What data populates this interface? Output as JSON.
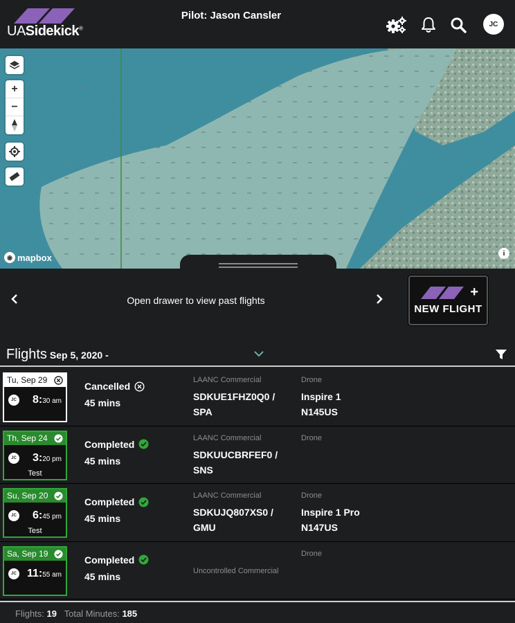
{
  "header": {
    "logo_text_light": "UA",
    "logo_text_bold": "Sidekick",
    "logo_mark": "®",
    "pilot": "Pilot: Jason Cansler",
    "icons": [
      "settings-gears-icon",
      "bell-icon",
      "search-icon"
    ],
    "avatar_initials": "JC"
  },
  "map": {
    "controls": [
      "layers-icon",
      "zoom-in-icon",
      "zoom-out-icon",
      "compass-icon",
      "locate-icon",
      "ruler-icon"
    ],
    "zoom_in": "+",
    "zoom_out": "−",
    "attribution": "mapbox",
    "info": "i",
    "colors": {
      "water": "#3f8ea0",
      "land": "#8fb7b1"
    }
  },
  "drawer": {
    "prompt": "Open drawer to view past flights",
    "new_flight_label": "NEW FLIGHT",
    "new_flight_plus": "+"
  },
  "flights_header": {
    "title": "Flights",
    "date": "Sep 5, 2020 -"
  },
  "flights": [
    {
      "date": "Tu, Sep 29",
      "state": "cancelled",
      "initials": "JC",
      "time_main": "8:",
      "time_min": "30 am",
      "note": "",
      "status": "Cancelled",
      "duration": "45 mins",
      "auth_type": "LAANC Commercial",
      "auth_line1": "SDKUE1FHZ0Q0 /",
      "auth_line2": "SPA",
      "drone_label": "Drone",
      "drone_line1": "Inspire 1",
      "drone_line2": "N145US"
    },
    {
      "date": "Th, Sep 24",
      "state": "completed",
      "initials": "JC",
      "time_main": "3:",
      "time_min": "20 pm",
      "note": "Test",
      "status": "Completed",
      "duration": "45 mins",
      "auth_type": "LAANC Commercial",
      "auth_line1": "SDKUUCBRFEF0 /",
      "auth_line2": "SNS",
      "drone_label": "Drone",
      "drone_line1": "",
      "drone_line2": ""
    },
    {
      "date": "Su, Sep 20",
      "state": "completed",
      "initials": "JC",
      "time_main": "6:",
      "time_min": "45 pm",
      "note": "Test",
      "status": "Completed",
      "duration": "45 mins",
      "auth_type": "LAANC Commercial",
      "auth_line1": "SDKUJQ807XS0 /",
      "auth_line2": "GMU",
      "drone_label": "Drone",
      "drone_line1": "Inspire 1 Pro",
      "drone_line2": "N147US"
    },
    {
      "date": "Sa, Sep 19",
      "state": "completed",
      "initials": "JC",
      "time_main": "11:",
      "time_min": "55 am",
      "note": "",
      "status": "Completed",
      "duration": "45 mins",
      "auth_type": "Uncontrolled Commercial",
      "auth_line1": "",
      "auth_line2": "",
      "drone_label": "Drone",
      "drone_line1": "",
      "drone_line2": ""
    }
  ],
  "footer": {
    "flights_label": "Flights:",
    "flights_count": "19",
    "minutes_label": "Total Minutes:",
    "minutes_total": "185"
  },
  "colors": {
    "accent_purple": "#8a63b8",
    "completed_green": "#2a8a2e",
    "background": "#1d1e20"
  }
}
